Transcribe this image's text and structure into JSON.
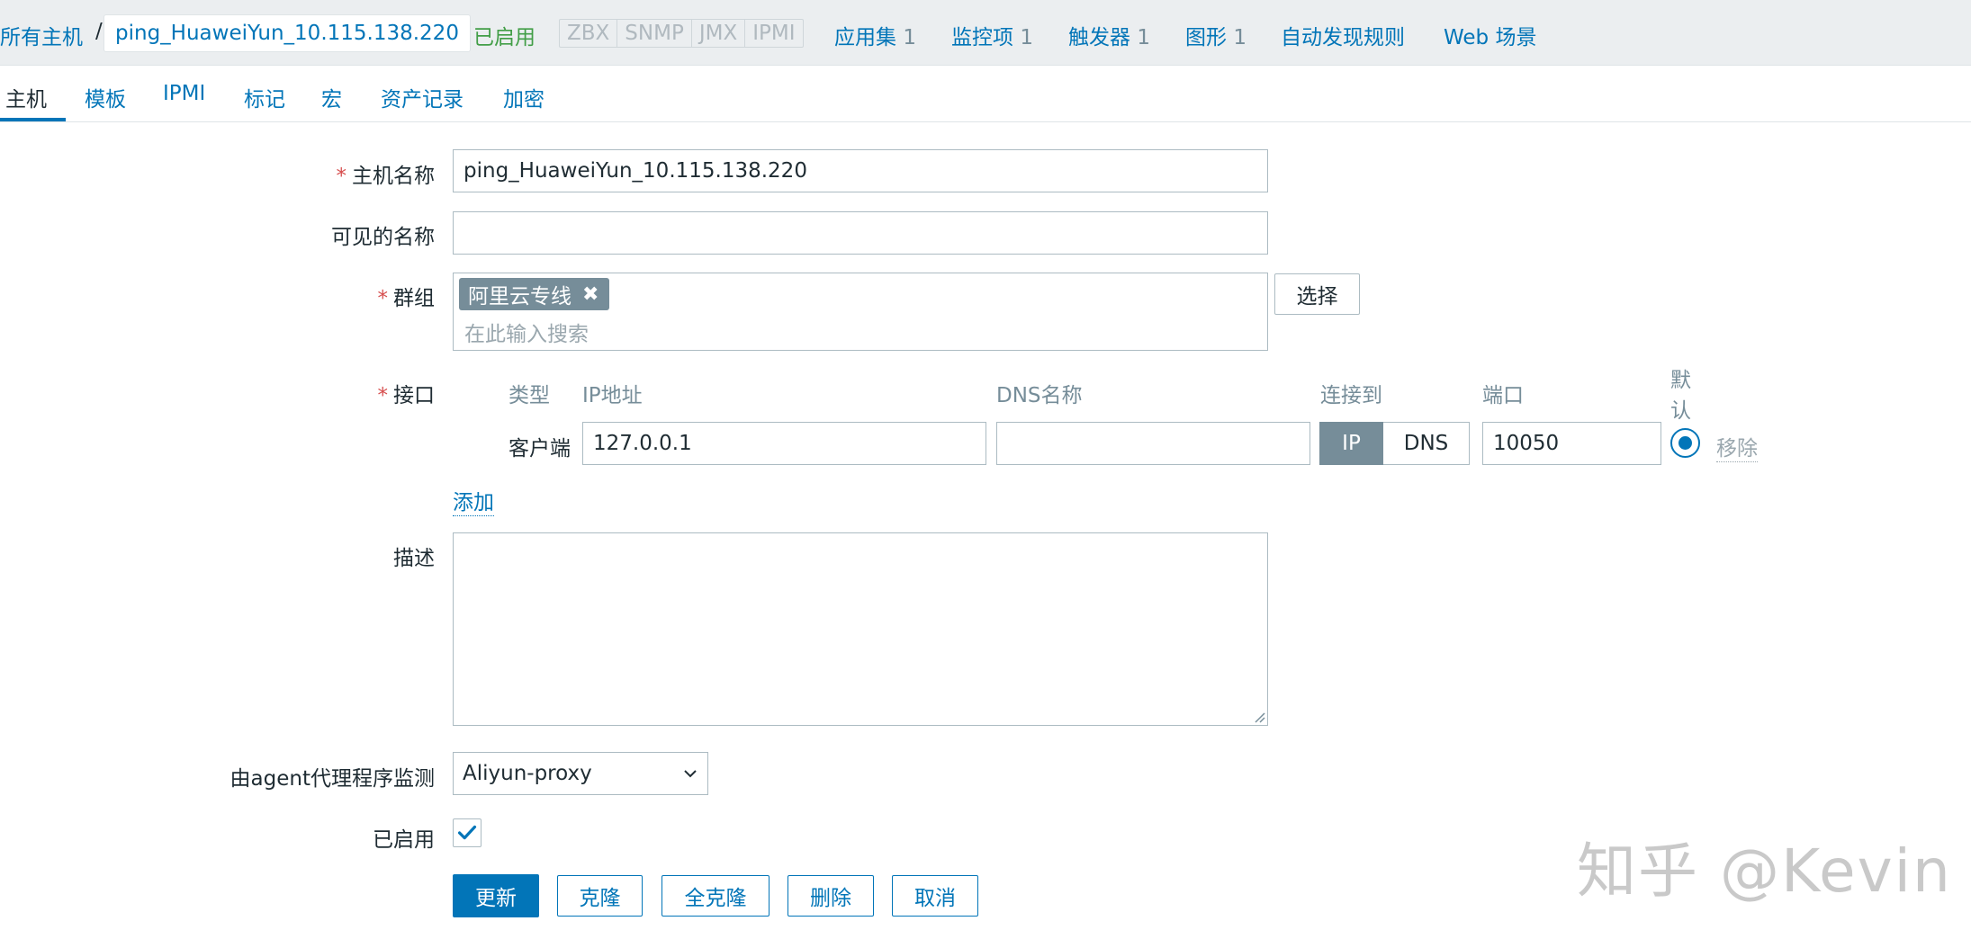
{
  "breadcrumb": {
    "all_hosts": "所有主机",
    "separator": "/",
    "current_host": "ping_HuaweiYun_10.115.138.220"
  },
  "status": {
    "enabled": "已启用",
    "color": "#429e47"
  },
  "availability": [
    "ZBX",
    "SNMP",
    "JMX",
    "IPMI"
  ],
  "top_links": {
    "applications": {
      "label": "应用集",
      "count": "1"
    },
    "items": {
      "label": "监控项",
      "count": "1"
    },
    "triggers": {
      "label": "触发器",
      "count": "1"
    },
    "graphs": {
      "label": "图形",
      "count": "1"
    },
    "discovery": {
      "label": "自动发现规则"
    },
    "web": {
      "label": "Web 场景"
    }
  },
  "tabs": [
    "主机",
    "模板",
    "IPMI",
    "标记",
    "宏",
    "资产记录",
    "加密"
  ],
  "form": {
    "required_mark": "*",
    "host_name_label": "主机名称",
    "host_name_value": "ping_HuaweiYun_10.115.138.220",
    "visible_name_label": "可见的名称",
    "visible_name_value": "",
    "groups_label": "群组",
    "group_chip": "阿里云专线",
    "group_chip_remove": "✖",
    "group_search_placeholder": "在此输入搜索",
    "select_button": "选择",
    "interfaces_label": "接口",
    "interface_columns": {
      "type": "类型",
      "ip": "IP地址",
      "dns": "DNS名称",
      "connect_to": "连接到",
      "port": "端口",
      "default_line1": "默",
      "default_line2": "认"
    },
    "interface_row": {
      "type": "客户端",
      "ip": "127.0.0.1",
      "dns": "",
      "connect_ip": "IP",
      "connect_dns": "DNS",
      "port": "10050",
      "remove": "移除"
    },
    "add_link": "添加",
    "description_label": "描述",
    "description_value": "",
    "proxy_label": "由agent代理程序监测",
    "proxy_value": "Aliyun-proxy",
    "enabled_label": "已启用",
    "enabled_checked": true
  },
  "buttons": {
    "update": "更新",
    "clone": "克隆",
    "full_clone": "全克隆",
    "delete": "删除",
    "cancel": "取消"
  },
  "watermark": "知乎 @Kevin",
  "colors": {
    "accent": "#0275b8",
    "required": "#d64e4e",
    "muted": "#768d99"
  }
}
